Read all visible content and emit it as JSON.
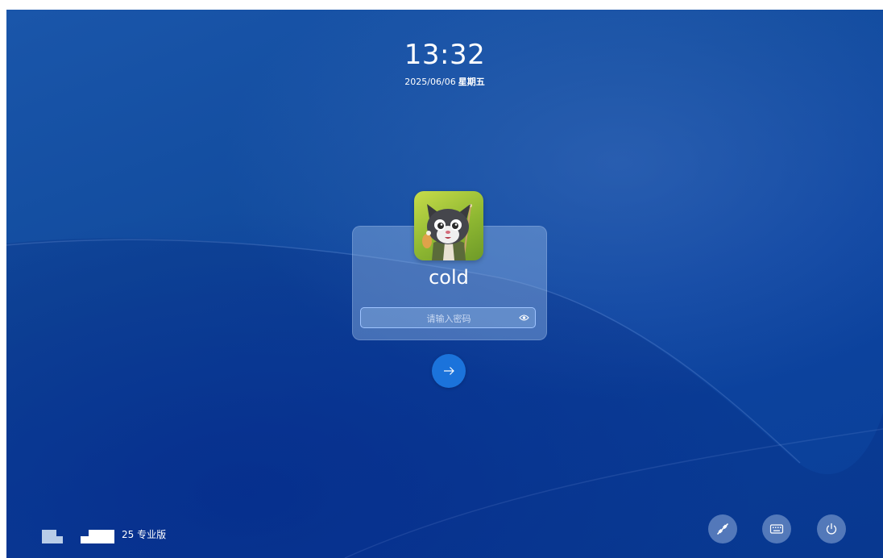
{
  "lockscreen": {
    "time": "13:32",
    "date": "2025/06/06",
    "weekday": "星期五"
  },
  "user": {
    "name": "cold",
    "avatar_icon": "cartoon-cat-avatar"
  },
  "password": {
    "placeholder": "请输入密码",
    "toggle_icon": "eye-icon"
  },
  "submit": {
    "icon": "arrow-right-icon"
  },
  "footer": {
    "version": "25 专业版",
    "logo_icon": "os-logo",
    "buttons": [
      {
        "name": "network",
        "icon": "network-icon"
      },
      {
        "name": "virtual-keyboard",
        "icon": "keyboard-icon"
      },
      {
        "name": "power",
        "icon": "power-icon"
      }
    ]
  },
  "colors": {
    "background": "#124c9f",
    "accent": "#1b73db",
    "field_border": "#9fc4ff"
  }
}
